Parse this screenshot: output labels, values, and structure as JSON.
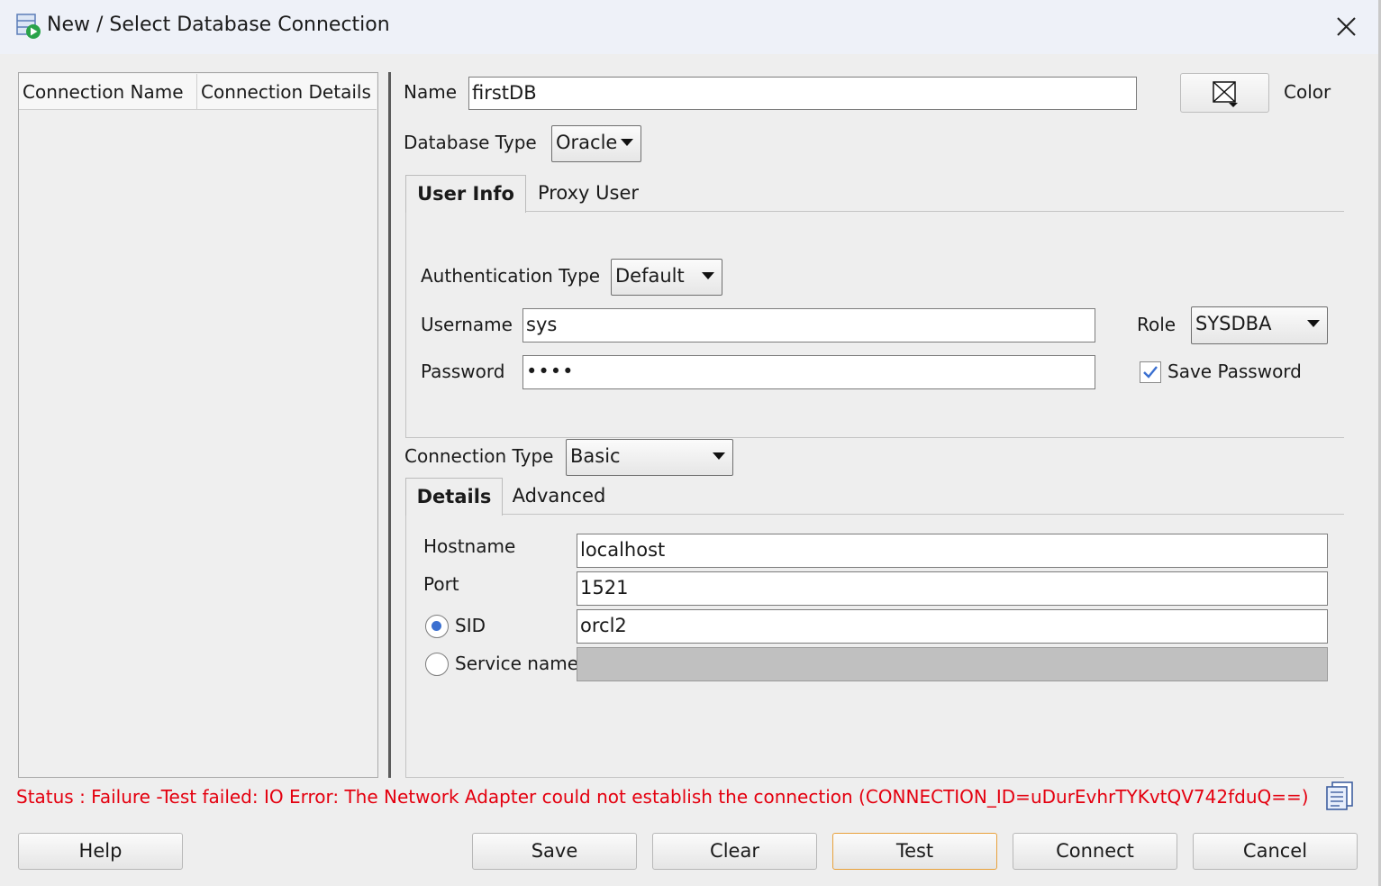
{
  "window": {
    "title": "New / Select Database Connection",
    "close_glyph": "✕"
  },
  "connections_table": {
    "columns": [
      "Connection Name",
      "Connection Details"
    ],
    "rows": []
  },
  "connection": {
    "name_label": "Name",
    "name_value": "firstDB",
    "color_label": "Color",
    "db_type_label": "Database Type",
    "db_type_value": "Oracle"
  },
  "user_tabs": [
    "User Info",
    "Proxy User"
  ],
  "user_info": {
    "auth_type_label": "Authentication Type",
    "auth_type_value": "Default",
    "username_label": "Username",
    "username_value": "sys",
    "password_label": "Password",
    "password_value": "••••",
    "role_label": "Role",
    "role_value": "SYSDBA",
    "save_password_label": "Save Password",
    "save_password_checked": true
  },
  "connection_type": {
    "label": "Connection Type",
    "value": "Basic"
  },
  "detail_tabs": [
    "Details",
    "Advanced"
  ],
  "details": {
    "hostname_label": "Hostname",
    "hostname_value": "localhost",
    "port_label": "Port",
    "port_value": "1521",
    "sid_label": "SID",
    "sid_value": "orcl2",
    "sid_selected": true,
    "service_name_label": "Service name",
    "service_name_value": ""
  },
  "status": {
    "text": "Status : Failure -Test failed: IO Error: The Network Adapter could not establish the connection (CONNECTION_ID=uDurEvhrTYKvtQV742fduQ==)",
    "color": "#e4000f"
  },
  "buttons": {
    "help": "Help",
    "save": "Save",
    "clear": "Clear",
    "test": "Test",
    "connect": "Connect",
    "cancel": "Cancel"
  },
  "icons": {
    "title_icon": "database-connection-icon",
    "color_icon": "color-picker-icon",
    "copy_icon": "copy-icon",
    "checkbox_icon": "checkmark-icon"
  },
  "colors": {
    "titlebar_bg": "#eef1f8",
    "dialog_bg": "#eeeeee",
    "default_button_border": "#e8a13c",
    "check_color": "#3a6fd0"
  }
}
